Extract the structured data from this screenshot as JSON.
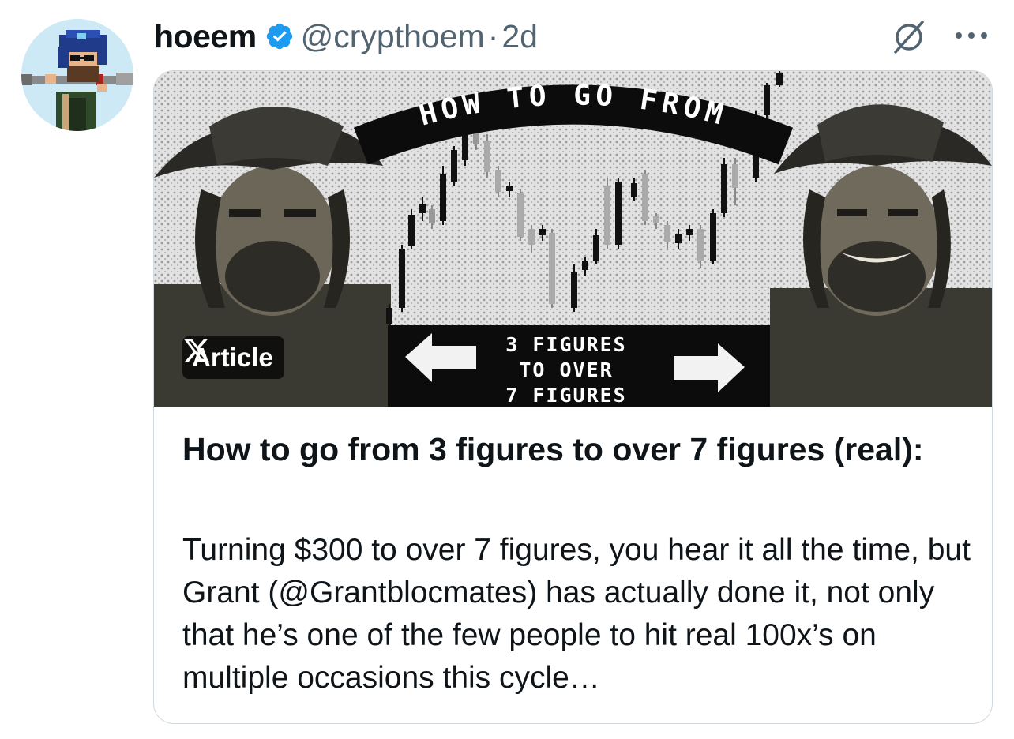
{
  "tweet": {
    "display_name": "hoeem",
    "handle": "@crypthoem",
    "separator": "·",
    "time": "2d",
    "avatar_icon": "pixel-avatar",
    "verified_icon": "verified-badge-icon",
    "grok_icon": "grok-icon",
    "more_icon": "more-options-icon",
    "verified_color": "#1d9bf0"
  },
  "article_card": {
    "image": {
      "arc_text": "HOW TO GO FROM",
      "banner_lines": [
        "3 FIGURES",
        "TO OVER",
        "7 FIGURES"
      ]
    },
    "badge_label": "Article",
    "title": "How to go from 3 figures to over 7 figures (real):",
    "description": "Turning $300 to over 7 figures, you hear it all the time, but Grant (@Grantblocmates) has actually done it, not only that he’s one of the few people to hit real 100x’s on multiple occasions this cycle…"
  }
}
